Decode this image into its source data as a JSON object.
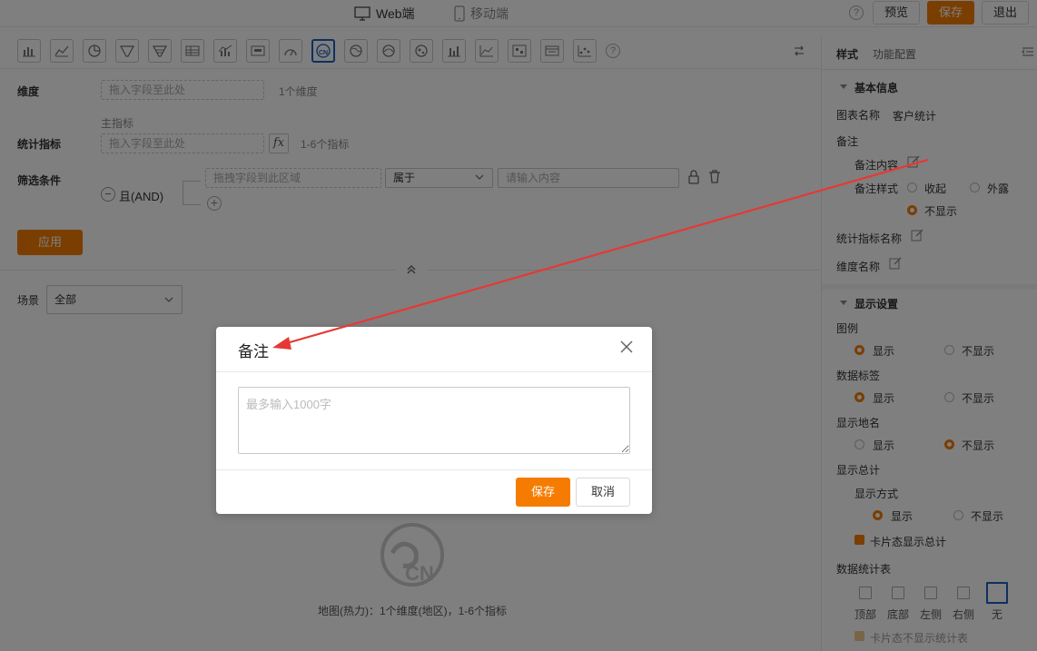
{
  "topbar": {
    "tab_web": "Web端",
    "tab_mobile": "移动端",
    "help_icon": "?",
    "preview_label": "预览",
    "save_label": "保存",
    "exit_label": "退出"
  },
  "toolbar": {
    "icons": [
      "bar-chart-icon",
      "line-chart-icon",
      "pie-chart-icon",
      "funnel-icon",
      "funnel-alt-icon",
      "table-icon",
      "combo-chart-icon",
      "card-icon",
      "gauge-icon",
      "map-heat-icon",
      "map-world-icon",
      "map-flow-icon",
      "map-bubble-icon",
      "bar-multi-icon",
      "scatter-icon",
      "pivot-icon",
      "detail-table-icon",
      "dot-chart-icon",
      "help-icon"
    ],
    "help_label": "?",
    "active_icon": "map-heat-icon"
  },
  "config": {
    "dimension_label": "维度",
    "dimension_placeholder": "拖入字段至此处",
    "dimension_hint": "1个维度",
    "main_metric_label": "主指标",
    "metric_label": "统计指标",
    "metric_placeholder": "拖入字段至此处",
    "metric_fx": "fx",
    "metric_hint": "1-6个指标",
    "filter_label": "筛选条件",
    "filter_logic": "且(AND)",
    "filter_logic_toggle": "−",
    "filter_field_placeholder": "拖拽字段到此区域",
    "filter_operator": "属于",
    "filter_value_placeholder": "请输入内容",
    "add_condition": "+",
    "apply_label": "应用"
  },
  "scene": {
    "label": "场景",
    "value": "全部"
  },
  "chart_placeholder": {
    "badge": "CN",
    "caption": "地图(热力)：1个维度(地区)，1-6个指标"
  },
  "right_panel": {
    "tab_style": "样式",
    "tab_function": "功能配置",
    "basic_info_title": "基本信息",
    "chart_name_label": "图表名称",
    "chart_name_value": "客户统计",
    "note_label": "备注",
    "note_content_label": "备注内容",
    "note_style_label": "备注样式",
    "note_style_options": [
      "收起",
      "外露",
      "不显示"
    ],
    "note_style_selected": "不显示",
    "metric_name_label": "统计指标名称",
    "dimension_name_label": "维度名称",
    "display_settings_title": "显示设置",
    "legend_label": "图例",
    "legend_options": [
      "显示",
      "不显示"
    ],
    "legend_selected": "显示",
    "data_label_label": "数据标签",
    "data_label_options": [
      "显示",
      "不显示"
    ],
    "data_label_selected": "显示",
    "region_name_label": "显示地名",
    "region_name_options": [
      "显示",
      "不显示"
    ],
    "region_name_selected": "不显示",
    "total_label": "显示总计",
    "display_mode_label": "显示方式",
    "display_mode_options": [
      "显示",
      "不显示"
    ],
    "display_mode_selected": "显示",
    "card_total_label": "卡片态显示总计",
    "stats_table_label": "数据统计表",
    "stats_positions": [
      "顶部",
      "底部",
      "左侧",
      "右侧",
      "无"
    ],
    "stats_selected": "无",
    "card_hide_stats_label": "卡片态不显示统计表"
  },
  "dialog": {
    "title": "备注",
    "textarea_placeholder": "最多输入1000字",
    "save_label": "保存",
    "cancel_label": "取消"
  },
  "colors": {
    "accent": "#f57c00",
    "active_border": "#1f5fbf",
    "annotation_arrow": "#e53935"
  }
}
